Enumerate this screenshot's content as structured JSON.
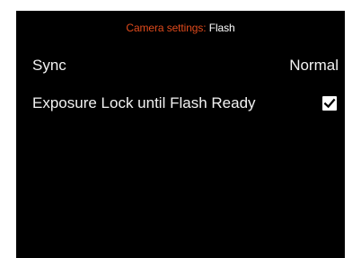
{
  "header": {
    "section_label": "Camera settings:",
    "page_label": "Flash",
    "section_color": "#e04a1c"
  },
  "settings": [
    {
      "label": "Sync",
      "value": "Normal"
    },
    {
      "label": "Exposure Lock until Flash Ready",
      "checked": true,
      "icon": "check-icon"
    }
  ]
}
